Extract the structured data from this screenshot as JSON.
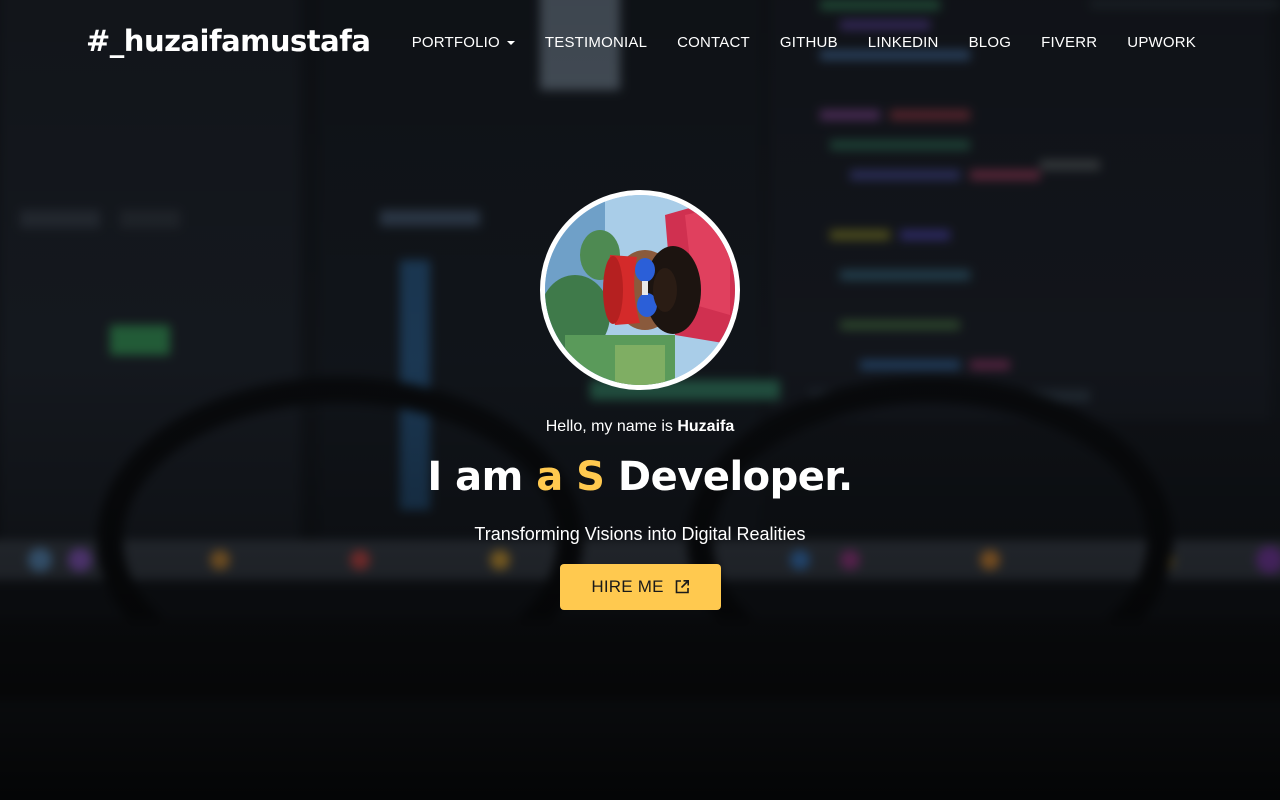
{
  "brand": {
    "title": "#_huzaifamustafa"
  },
  "nav": {
    "items": [
      {
        "label": "PORTFOLIO",
        "has_dropdown": true
      },
      {
        "label": "TESTIMONIAL"
      },
      {
        "label": "CONTACT"
      },
      {
        "label": "GITHUB"
      },
      {
        "label": "LINKEDIN"
      },
      {
        "label": "BLOG"
      },
      {
        "label": "FIVERR"
      },
      {
        "label": "UPWORK"
      }
    ]
  },
  "hero": {
    "greeting_prefix": "Hello, my name is ",
    "greeting_name": "Huzaifa",
    "headline_prefix": "I am ",
    "headline_typed": "a S",
    "headline_suffix": " Developer.",
    "tagline": "Transforming Visions into Digital Realities",
    "cta_label": "HIRE ME",
    "cta_icon": "external-link-icon"
  },
  "colors": {
    "accent": "#ffc94f",
    "text": "#ffffff",
    "background": "#0c0e12"
  }
}
